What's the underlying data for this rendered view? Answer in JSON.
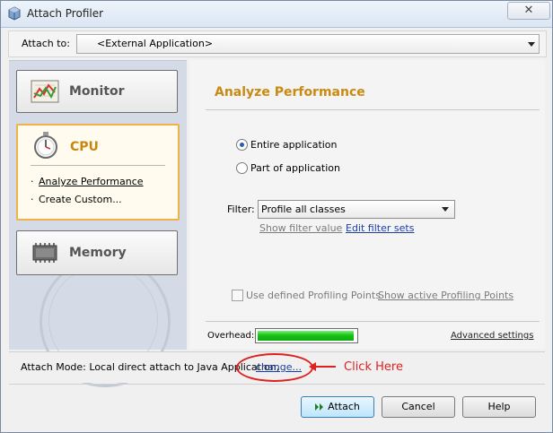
{
  "window": {
    "title": "Attach Profiler",
    "close_glyph": "✕"
  },
  "attach_to": {
    "label": "Attach to:",
    "value": "<External Application>"
  },
  "modes": {
    "monitor_label": "Monitor",
    "cpu_label": "CPU",
    "memory_label": "Memory",
    "cpu_options": [
      "Analyze Performance",
      "Create Custom..."
    ]
  },
  "panel": {
    "heading": "Analyze Performance",
    "radio_entire": "Entire application",
    "radio_part": "Part of application",
    "selected_radio": "Entire application",
    "filter_label": "Filter:",
    "filter_value": "Profile all classes",
    "show_filter_value": "Show filter value",
    "edit_filter_sets": "Edit filter sets",
    "use_profiling_points": "Use defined Profiling Points",
    "use_profiling_points_checked": false,
    "show_profiling_points": "Show active Profiling Points",
    "overhead_label": "Overhead:",
    "overhead_level": 0.98,
    "advanced_settings": "Advanced settings"
  },
  "attach_mode": {
    "text": "Attach Mode:  Local direct attach to Java Application,",
    "change_link": "change..."
  },
  "annotation": {
    "text": "Click Here",
    "color": "#e02020"
  },
  "buttons": {
    "attach": "Attach",
    "cancel": "Cancel",
    "help": "Help"
  },
  "icons": [
    "app-cube-icon",
    "monitor-chart-icon",
    "stopwatch-icon",
    "memory-chip-icon",
    "play-icon",
    "dropdown-arrow-icon"
  ],
  "colors": {
    "cpu_accent": "#c5870f",
    "heading": "#c98a12",
    "link": "#1b3ea8",
    "overhead_green": "#16c316"
  }
}
